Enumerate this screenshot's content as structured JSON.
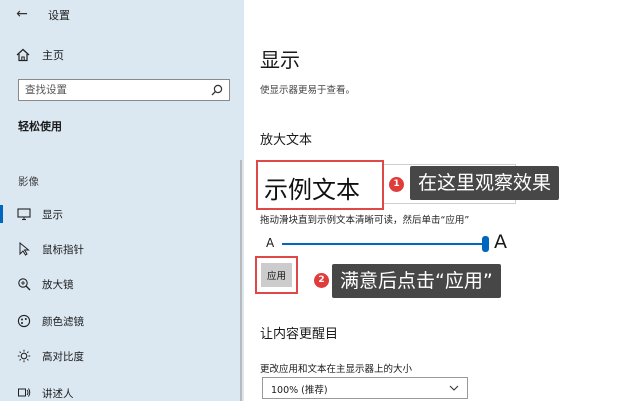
{
  "window": {
    "title": "设置",
    "minimize": "—",
    "maximize": "☐",
    "close": "✕"
  },
  "sidebar": {
    "home_label": "主页",
    "search_placeholder": "查找设置",
    "section_title": "轻松使用",
    "group_title": "影像",
    "items": [
      {
        "label": "显示",
        "icon": "monitor-icon",
        "active": true
      },
      {
        "label": "鼠标指针",
        "icon": "mouse-pointer-icon",
        "active": false
      },
      {
        "label": "放大镜",
        "icon": "magnifier-icon",
        "active": false
      },
      {
        "label": "颜色滤镜",
        "icon": "color-filter-icon",
        "active": false
      },
      {
        "label": "高对比度",
        "icon": "high-contrast-icon",
        "active": false
      },
      {
        "label": "讲述人",
        "icon": "narrator-icon",
        "active": false
      }
    ]
  },
  "main": {
    "title": "显示",
    "description": "使显示器更易于查看。",
    "enlarge_text_title": "放大文本",
    "sample_text": "示例文本",
    "instruction": "拖动滑块直到示例文本清晰可读，然后单击“应用”",
    "slider_min_label": "A",
    "slider_max_label": "A",
    "slider_value": 1.0,
    "apply_label": "应用",
    "prominent_title": "让内容更醒目",
    "size_label": "更改应用和文本在主显示器上的大小",
    "size_value": "100% (推荐)"
  },
  "annotations": [
    {
      "number": "1",
      "text": "在这里观察效果"
    },
    {
      "number": "2",
      "text": "满意后点击“应用”"
    }
  ],
  "colors": {
    "accent": "#0067c0",
    "sidebar_bg": "#dbe8f2",
    "highlight_border": "#e04848",
    "badge": "#e03c3c",
    "callout_bg": "#474747"
  }
}
